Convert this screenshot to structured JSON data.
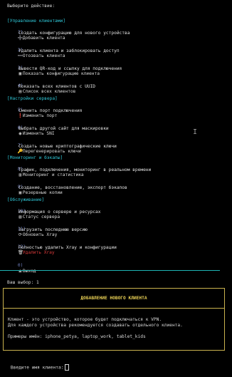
{
  "prompt": "Выберите действие:",
  "sections": {
    "clients": "[Управление клиентами]",
    "server": "[Настройки сервера]",
    "monitoring": "[Мониторинг и бэкапы]",
    "service": "[Обслуживание]"
  },
  "items": [
    {
      "num": "1)",
      "icon": "➕",
      "label": "Добавить клиента",
      "desc": "Создать конфигурацию для нового устройства"
    },
    {
      "num": "2)",
      "icon": "➖",
      "label": "Отозвать клиента",
      "desc": "Удалить клиента и заблокировать доступ"
    },
    {
      "num": "3)",
      "icon": "▦",
      "label": "Показать конфигурацию клиента",
      "desc": "Вывести QR-код и ссылку для подключения"
    },
    {
      "num": "4)",
      "icon": "▤",
      "label": "Список всех клиентов",
      "desc": "Показать всех клиентов с UUID"
    },
    {
      "num": "5)",
      "icon": "❗",
      "label": "Изменить порт",
      "desc": "Сменить порт подключения"
    },
    {
      "num": "6)",
      "icon": "◉",
      "label": "Изменить SNI",
      "desc": "Выбрать другой сайт для маскировки"
    },
    {
      "num": "7)",
      "icon": "🔑",
      "label": "Перегенерировать ключи",
      "desc": "Создать новые криптографические ключи"
    },
    {
      "num": "8)",
      "icon": "▥",
      "label": "Мониторинг и статистика",
      "desc": "Трафик, подключения, мониторинг в реальном времени"
    },
    {
      "num": "9)",
      "icon": "▣",
      "label": "Резервные копии",
      "desc": "Создание, восстановление, экспорт бэкапов"
    },
    {
      "num": "10)",
      "icon": "▧",
      "label": "Статус сервера",
      "desc": "Информация о сервере и ресурсах"
    },
    {
      "num": "11)",
      "icon": "⟳",
      "label": "Обновить Xray",
      "desc": "Загрузить последнюю версию"
    },
    {
      "num": "12)",
      "icon": "🗑",
      "label": "Удалить Xray",
      "desc": "Полностью удалить Xray и конфигурации"
    },
    {
      "num": "0)",
      "icon": "⏏",
      "label": "Выход"
    }
  ],
  "choice": "Ваш выбор: 1",
  "dialog": {
    "title": "ДОБАВЛЕНИЕ НОВОГО КЛИЕНТА",
    "line1": "Клиент - это устройство, которое будет подключаться к VPN.",
    "line2": "Для каждого устройства рекомендуется создавать отдельного клиента.",
    "examples": "Примеры имён: iphone_petya, laptop_work, tablet_kids"
  },
  "input_prompt": "Введите имя клиента:",
  "colors": {
    "background": "#000000",
    "text": "#d8d8d8",
    "section": "#2fc6d6",
    "dialog_border": "#c9b24e",
    "danger": "#d83a3a"
  }
}
